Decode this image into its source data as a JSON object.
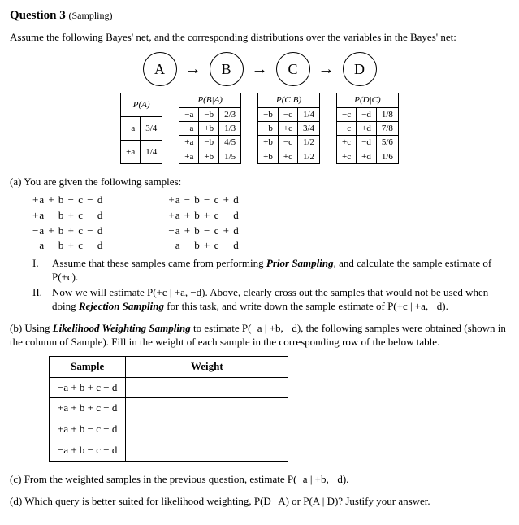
{
  "header": {
    "title": "Question 3",
    "subtitle": "(Sampling)"
  },
  "intro": "Assume the following Bayes' net, and the corresponding distributions over the variables in the Bayes' net:",
  "bayes_net": {
    "nodes": [
      "A",
      "B",
      "C",
      "D"
    ]
  },
  "cpt": {
    "pa": {
      "header": "P(A)",
      "rows": [
        [
          "−a",
          "3/4"
        ],
        [
          "+a",
          "1/4"
        ]
      ]
    },
    "pba": {
      "header": "P(B|A)",
      "rows": [
        [
          "−a",
          "−b",
          "2/3"
        ],
        [
          "−a",
          "+b",
          "1/3"
        ],
        [
          "+a",
          "−b",
          "4/5"
        ],
        [
          "+a",
          "+b",
          "1/5"
        ]
      ]
    },
    "pcb": {
      "header": "P(C|B)",
      "rows": [
        [
          "−b",
          "−c",
          "1/4"
        ],
        [
          "−b",
          "+c",
          "3/4"
        ],
        [
          "+b",
          "−c",
          "1/2"
        ],
        [
          "+b",
          "+c",
          "1/2"
        ]
      ]
    },
    "pdc": {
      "header": "P(D|C)",
      "rows": [
        [
          "−c",
          "−d",
          "1/8"
        ],
        [
          "−c",
          "+d",
          "7/8"
        ],
        [
          "+c",
          "−d",
          "5/6"
        ],
        [
          "+c",
          "+d",
          "1/6"
        ]
      ]
    }
  },
  "part_a": {
    "label": "(a)",
    "lead": "You are given the following samples:",
    "samples": {
      "col1": [
        "+a + b − c − d",
        "+a − b + c − d",
        "−a + b + c − d",
        "−a − b + c − d"
      ],
      "col2": [
        "+a − b − c + d",
        "+a + b + c − d",
        "−a + b − c + d",
        "−a − b + c − d"
      ]
    },
    "i": {
      "label": "I.",
      "text_pre": "Assume that these samples came from performing ",
      "em": "Prior Sampling",
      "text_post": ", and calculate the sample estimate of P(+c)."
    },
    "ii": {
      "label": "II.",
      "text_pre": "Now we will estimate P(+c | +a, −d). Above, clearly cross out the samples that would not be used when doing ",
      "em": "Rejection Sampling",
      "text_post": " for this task, and write down the sample estimate of P(+c | +a, −d)."
    }
  },
  "part_b": {
    "label": "(b)",
    "text_pre": "Using ",
    "em": "Likelihood Weighting Sampling",
    "text_post": " to estimate P(−a | +b, −d), the following samples were obtained (shown in the column of Sample). Fill in the weight of each sample in the corresponding row of the below table.",
    "table": {
      "h1": "Sample",
      "h2": "Weight",
      "rows": [
        "−a + b + c − d",
        "+a + b + c − d",
        "+a + b − c − d",
        "−a + b − c − d"
      ]
    }
  },
  "part_c": {
    "label": "(c)",
    "text": "From the weighted samples in the previous question, estimate P(−a | +b, −d)."
  },
  "part_d": {
    "label": "(d)",
    "text": "Which query is better suited for likelihood weighting, P(D | A) or P(A | D)? Justify your answer."
  }
}
